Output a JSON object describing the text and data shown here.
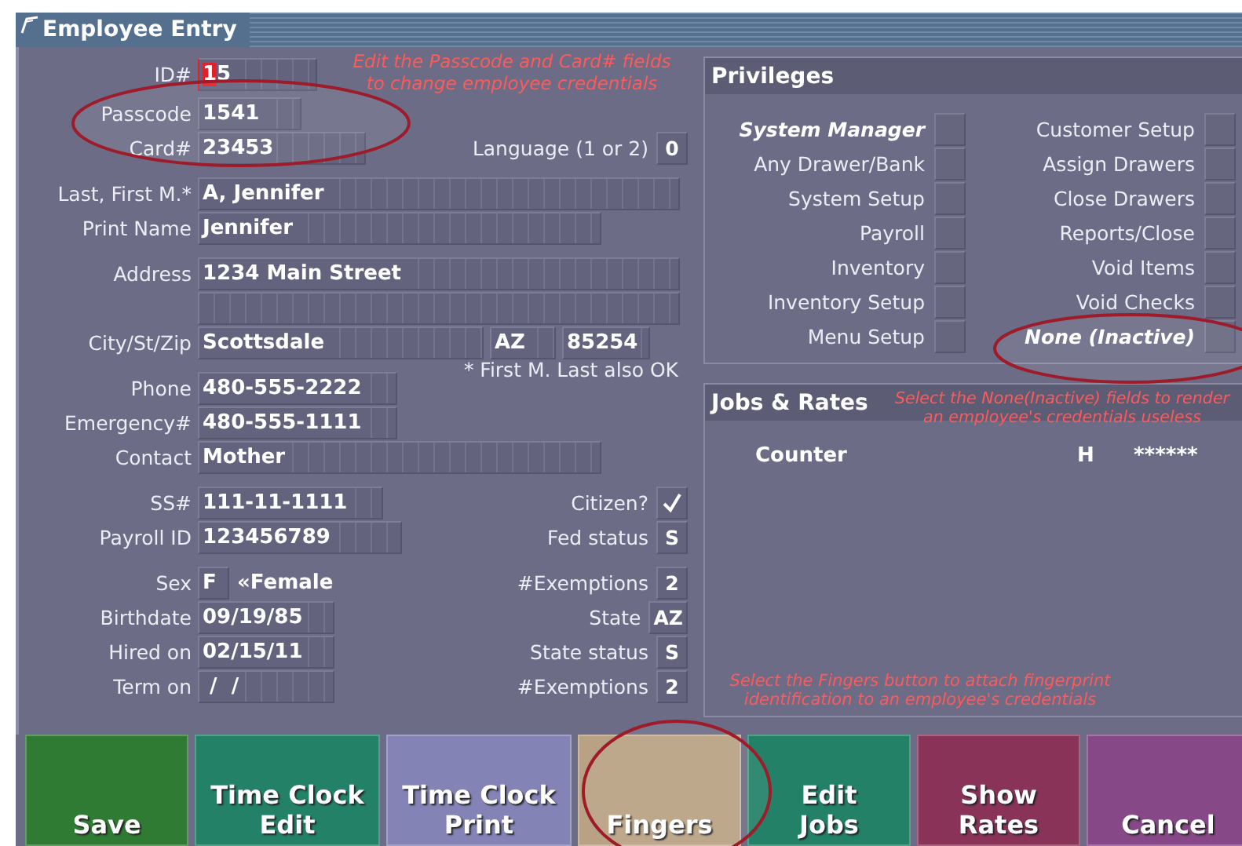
{
  "window": {
    "title": "Employee Entry"
  },
  "form": {
    "groups": [
      {
        "rows": [
          {
            "label": "ID#",
            "fields": [
              {
                "value": "15",
                "focused": true
              }
            ]
          },
          {
            "label": "Passcode",
            "fields": [
              {
                "value": "1541",
                "focused": false
              }
            ]
          },
          {
            "label": "Card#",
            "fields": [
              {
                "value": "23453",
                "focused": false
              }
            ],
            "side": {
              "kind": "box",
              "label": "Language (1 or 2)",
              "value": "0"
            }
          }
        ]
      },
      {
        "rows": [
          {
            "label": "Last, First M.*",
            "fields": [
              {
                "value": "A, Jennifer",
                "focused": false
              }
            ]
          },
          {
            "label": "Print Name",
            "fields": [
              {
                "value": "Jennifer",
                "focused": false
              }
            ]
          }
        ]
      },
      {
        "rows": [
          {
            "label": "Address",
            "fields": [
              {
                "value": "1234 Main Street",
                "focused": false
              }
            ]
          },
          {
            "fields": [
              {
                "focused": false
              }
            ]
          },
          {
            "label": "City/St/Zip",
            "fields": [
              {
                "value": "Scottsdale",
                "focused": false
              },
              {
                "value": "AZ",
                "focused": false
              },
              {
                "value": "85254",
                "focused": false
              }
            ]
          }
        ]
      },
      {
        "rows": [
          {
            "label": "Phone",
            "fields": [
              {
                "value": "480-555-2222",
                "focused": false
              }
            ],
            "side": {
              "kind": "note",
              "text": "* First M. Last also OK"
            }
          },
          {
            "label": "Emergency#",
            "fields": [
              {
                "value": "480-555-1111",
                "focused": false
              }
            ]
          },
          {
            "label": "Contact",
            "fields": [
              {
                "value": "Mother",
                "focused": false
              }
            ]
          }
        ]
      },
      {
        "rows": [
          {
            "label": "SS#",
            "fields": [
              {
                "value": "111-11-1111",
                "focused": false
              }
            ],
            "side": {
              "kind": "check",
              "label": "Citizen?",
              "checked": true
            }
          },
          {
            "label": "Payroll ID",
            "fields": [
              {
                "value": "123456789",
                "focused": false
              }
            ],
            "side": {
              "kind": "box",
              "label": "Fed status",
              "value": "S"
            }
          }
        ]
      },
      {
        "rows": [
          {
            "label": "Sex",
            "fields": [
              {
                "value": "F",
                "focused": false
              }
            ],
            "suffix": "«Female",
            "side": {
              "kind": "box",
              "label": "#Exemptions",
              "value": "2"
            }
          },
          {
            "label": "Birthdate",
            "fields": [
              {
                "value": "09/19/85",
                "focused": false
              }
            ],
            "side": {
              "kind": "box",
              "label": "State",
              "value": "AZ"
            }
          },
          {
            "label": "Hired on",
            "fields": [
              {
                "value": "02/15/11",
                "focused": false
              }
            ],
            "side": {
              "kind": "box",
              "label": "State status",
              "value": "S"
            }
          },
          {
            "label": "Term on",
            "fields": [
              {
                "value": " /  /",
                "focused": false
              }
            ],
            "side": {
              "kind": "box",
              "label": "#Exemptions",
              "value": "2"
            }
          }
        ]
      }
    ]
  },
  "privileges": {
    "title": "Privileges",
    "columns": [
      [
        {
          "label": "System Manager",
          "kind": "master",
          "checked": false
        },
        {
          "label": "Any Drawer/Bank",
          "kind": "normal",
          "checked": false
        },
        {
          "label": "System Setup",
          "kind": "normal",
          "checked": false
        },
        {
          "label": "Payroll",
          "kind": "normal",
          "checked": false
        },
        {
          "label": "Inventory",
          "kind": "normal",
          "checked": false
        },
        {
          "label": "Inventory Setup",
          "kind": "normal",
          "checked": false
        },
        {
          "label": "Menu Setup",
          "kind": "normal",
          "checked": false
        }
      ],
      [
        {
          "label": "Customer Setup",
          "kind": "normal",
          "checked": false
        },
        {
          "label": "Assign Drawers",
          "kind": "normal",
          "checked": false
        },
        {
          "label": "Close Drawers",
          "kind": "normal",
          "checked": false
        },
        {
          "label": "Reports/Close",
          "kind": "normal",
          "checked": false
        },
        {
          "label": "Void Items",
          "kind": "normal",
          "checked": false
        },
        {
          "label": "Void Checks",
          "kind": "normal",
          "checked": false
        },
        {
          "label": "None (Inactive)",
          "kind": "master",
          "checked": false
        }
      ]
    ]
  },
  "jobs": {
    "title": "Jobs & Rates",
    "rows": [
      {
        "job": "Counter",
        "type": "H",
        "rate": "******"
      }
    ]
  },
  "buttons": [
    {
      "label": "Save",
      "color": "#2f7b33"
    },
    {
      "label": "Time Clock Edit",
      "color": "#228166"
    },
    {
      "label": "Time Clock Print",
      "color": "#8383b5"
    },
    {
      "label": "Fingers",
      "color": "#b9a183"
    },
    {
      "label": "Edit Jobs",
      "color": "#228166"
    },
    {
      "label": "Show Rates",
      "color": "#893359"
    },
    {
      "label": "Cancel",
      "color": "#874887"
    }
  ],
  "callouts": [
    {
      "kind": "note",
      "text": "Edit the Passcode and Card# fields to change employee credentials"
    },
    {
      "kind": "oval"
    },
    {
      "kind": "oval"
    },
    {
      "kind": "note",
      "text": "Select the None(Inactive) fields to render an employee's credentials useless"
    },
    {
      "kind": "note",
      "text": "Select the Fingers button to attach fingerprint identification to an employee's credentials"
    },
    {
      "kind": "oval"
    }
  ]
}
